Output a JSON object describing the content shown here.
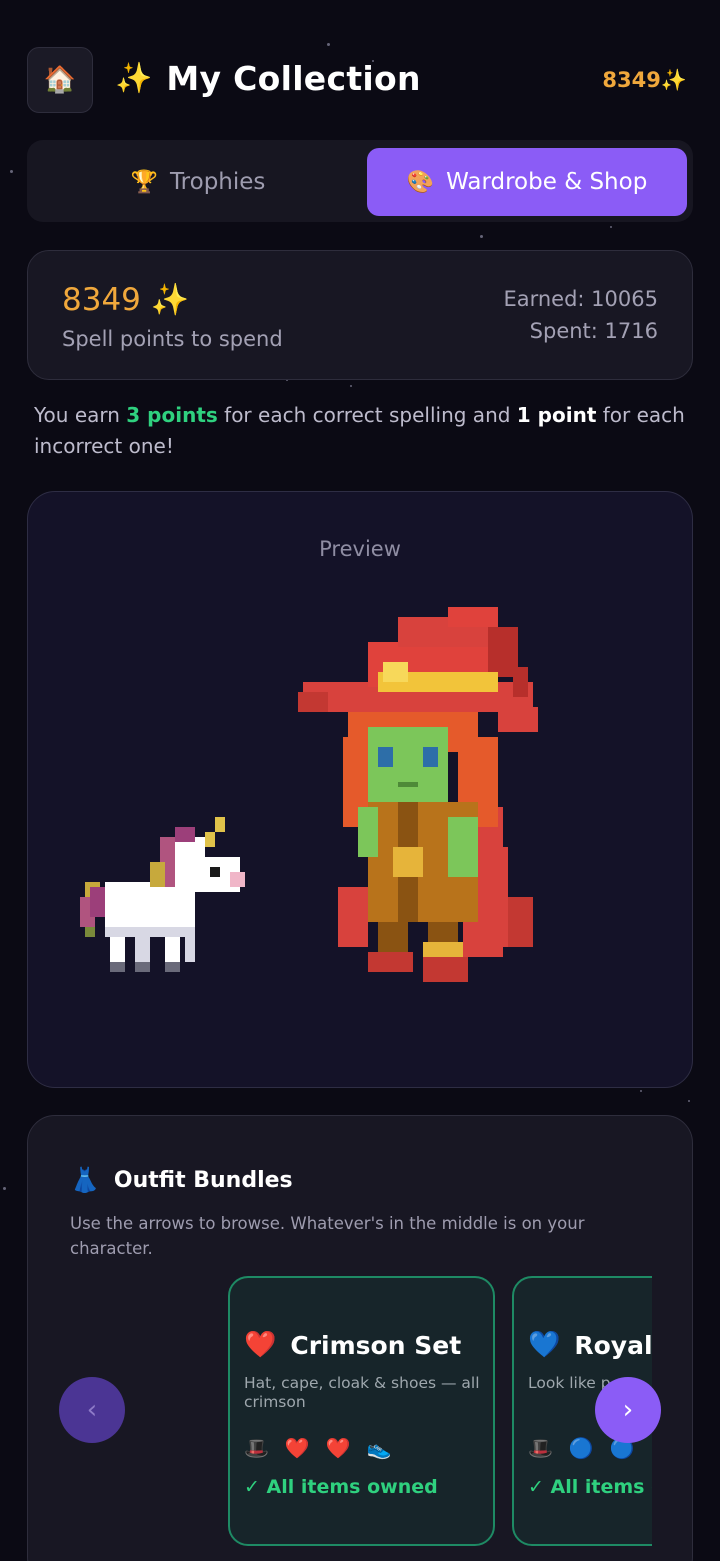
{
  "header": {
    "home_icon": "🏠",
    "sparkle": "✨",
    "title": "My Collection",
    "points": "8349✨"
  },
  "tabs": [
    {
      "label": "Trophies",
      "icon": "🏆",
      "active": false
    },
    {
      "label": "Wardrobe & Shop",
      "icon": "🎨",
      "active": true
    }
  ],
  "points_card": {
    "balance": "8349 ✨",
    "balance_label": "Spell points to spend",
    "earned": "Earned: 10065",
    "spent": "Spent: 1716"
  },
  "info": {
    "part1": "You earn ",
    "points_correct": "3 points",
    "part2": " for each correct spelling and ",
    "points_incorrect": "1 point",
    "part3": " for each incorrect one!"
  },
  "preview": {
    "label": "Preview"
  },
  "bundles": {
    "icon": "👗",
    "title": "Outfit Bundles",
    "description": "Use the arrows to browse. Whatever's in the middle is on your character.",
    "items": [
      {
        "icon": "❤️",
        "name": "Crimson Set",
        "description": "Hat, cape, cloak & shoes — all crimson",
        "item_icons": [
          "🎩",
          "❤️",
          "❤️",
          "👟"
        ],
        "status": "✓ All items owned"
      },
      {
        "icon": "💙",
        "name": "Royal",
        "description": "Look like p",
        "item_icons": [
          "🎩",
          "🔵",
          "🔵"
        ],
        "status": "✓ All items ov"
      }
    ],
    "prev_label": "‹",
    "next_label": "›"
  },
  "colors": {
    "accent": "#8b5cf6",
    "points": "#f0a83c",
    "success": "#2fd17f",
    "background": "#0b0a14"
  }
}
